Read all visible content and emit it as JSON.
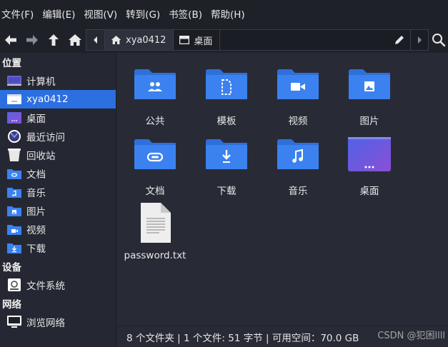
{
  "menubar": {
    "items": [
      "文件(F)",
      "编辑(E)",
      "视图(V)",
      "转到(G)",
      "书签(B)",
      "帮助(H)"
    ]
  },
  "toolbar": {
    "back_icon": "arrow-left-icon",
    "forward_icon": "arrow-right-icon",
    "up_icon": "arrow-up-icon",
    "home_icon": "home-icon",
    "breadcrumbs": [
      {
        "label": "xya0412",
        "icon": "home-icon"
      },
      {
        "label": "桌面",
        "icon": "desktop-icon"
      }
    ],
    "edit_path_icon": "pencil-icon",
    "search_icon": "search-icon"
  },
  "sidebar": {
    "sections": [
      {
        "heading": "位置",
        "items": [
          {
            "label": "计算机",
            "icon": "computer-icon",
            "selected": false
          },
          {
            "label": "xya0412",
            "icon": "home-folder-icon",
            "selected": true
          },
          {
            "label": "桌面",
            "icon": "desktop-icon",
            "selected": false
          },
          {
            "label": "最近访问",
            "icon": "recent-icon",
            "selected": false
          },
          {
            "label": "回收站",
            "icon": "trash-icon",
            "selected": false
          },
          {
            "label": "文档",
            "icon": "documents-folder-icon",
            "selected": false
          },
          {
            "label": "音乐",
            "icon": "music-folder-icon",
            "selected": false
          },
          {
            "label": "图片",
            "icon": "pictures-folder-icon",
            "selected": false
          },
          {
            "label": "视频",
            "icon": "videos-folder-icon",
            "selected": false
          },
          {
            "label": "下载",
            "icon": "downloads-folder-icon",
            "selected": false
          }
        ]
      },
      {
        "heading": "设备",
        "items": [
          {
            "label": "文件系统",
            "icon": "drive-icon",
            "selected": false
          }
        ]
      },
      {
        "heading": "网络",
        "items": [
          {
            "label": "浏览网络",
            "icon": "network-icon",
            "selected": false
          }
        ]
      }
    ]
  },
  "files": [
    {
      "label": "公共",
      "icon": "public-folder-icon"
    },
    {
      "label": "模板",
      "icon": "templates-folder-icon"
    },
    {
      "label": "视频",
      "icon": "videos-folder-icon"
    },
    {
      "label": "图片",
      "icon": "pictures-folder-icon"
    },
    {
      "label": "文档",
      "icon": "documents-folder-icon"
    },
    {
      "label": "下载",
      "icon": "downloads-folder-icon"
    },
    {
      "label": "音乐",
      "icon": "music-folder-icon"
    },
    {
      "label": "桌面",
      "icon": "desktop-folder-icon"
    },
    {
      "label": "password.txt",
      "icon": "text-file-icon"
    }
  ],
  "statusbar": {
    "text": "8 个文件夹 | 1 个文件: 51 字节 | 可用空间：70.0 GB"
  },
  "watermark": "CSDN @犯困llll",
  "colors": {
    "folder_blue": "#3b82f0",
    "folder_tab": "#2f6fd9",
    "selection": "#2b6fe0",
    "background": "#282b36",
    "sidebar_bg": "#252833",
    "menubar_bg": "#1f2129"
  }
}
